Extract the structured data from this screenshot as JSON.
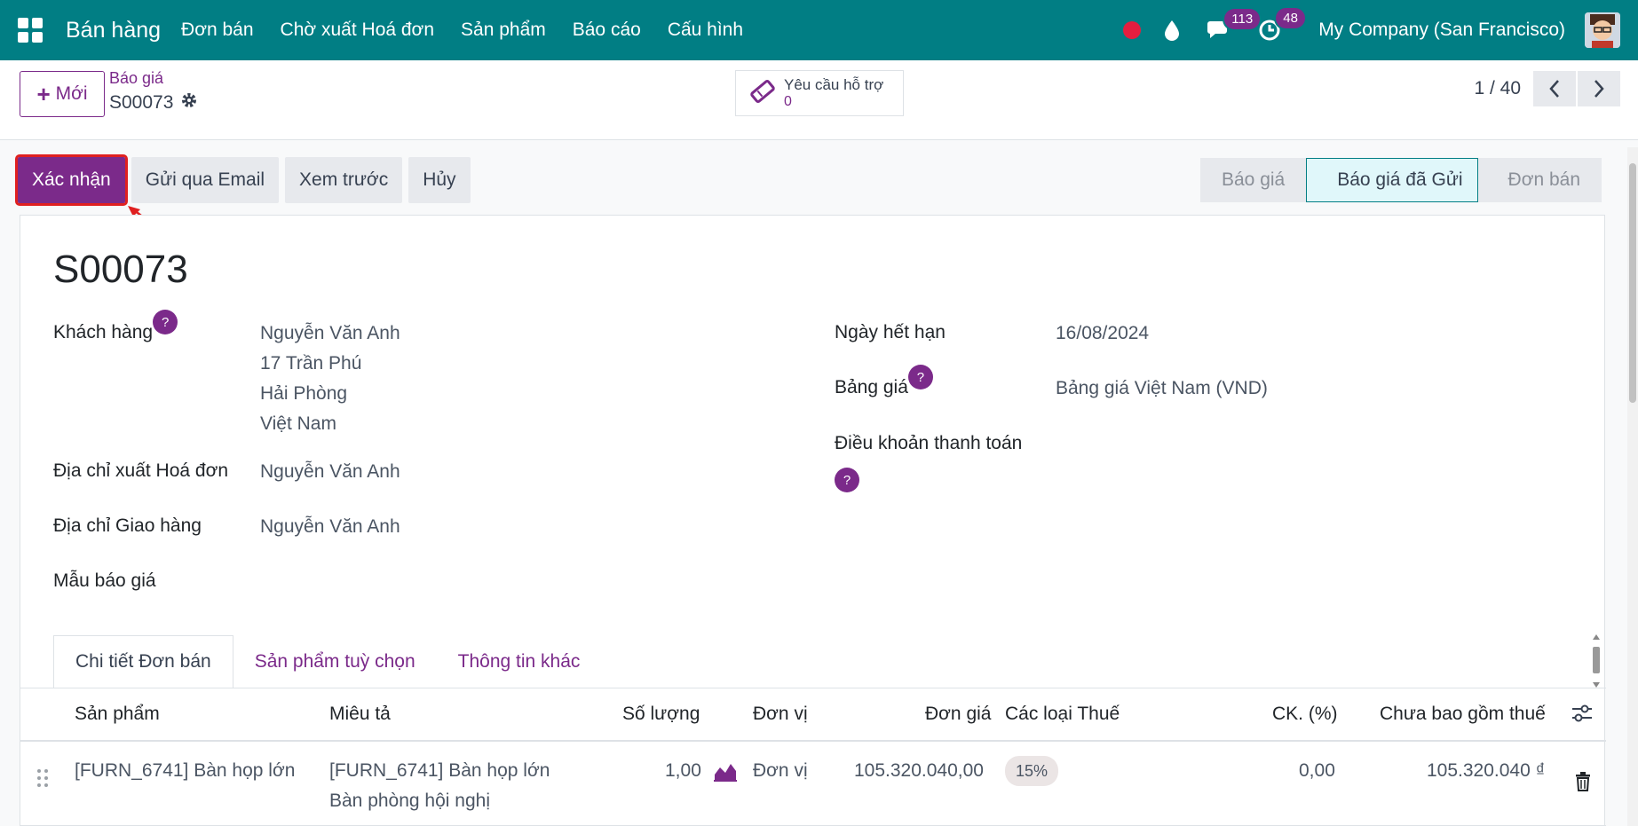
{
  "navbar": {
    "app_name": "Bán hàng",
    "menu": [
      "Đơn bán",
      "Chờ xuất Hoá đơn",
      "Sản phẩm",
      "Báo cáo",
      "Cấu hình"
    ],
    "chat_count": "113",
    "activity_count": "48",
    "company": "My Company (San Francisco)"
  },
  "control": {
    "new_label": "Mới",
    "breadcrumb_parent": "Báo giá",
    "breadcrumb_current": "S00073",
    "support_label": "Yêu cầu hỗ trợ",
    "support_count": "0",
    "pager": "1 / 40"
  },
  "actions": [
    "Xác nhận",
    "Gửi qua Email",
    "Xem trước",
    "Hủy"
  ],
  "status": {
    "stages": [
      "Báo giá",
      "Báo giá đã Gửi",
      "Đơn bán"
    ],
    "active": "Báo giá đã Gửi"
  },
  "form": {
    "title": "S00073",
    "customer_label": "Khách hàng",
    "customer_lines": [
      "Nguyễn Văn Anh",
      "17 Trần Phú",
      "Hải Phòng",
      "Việt Nam"
    ],
    "invoice_addr_label": "Địa chỉ xuất Hoá đơn",
    "invoice_addr": "Nguyễn Văn Anh",
    "delivery_addr_label": "Địa chỉ Giao hàng",
    "delivery_addr": "Nguyễn Văn Anh",
    "template_label": "Mẫu báo giá",
    "expiry_label": "Ngày hết hạn",
    "expiry": "16/08/2024",
    "pricelist_label": "Bảng giá",
    "pricelist": "Bảng giá Việt Nam (VND)",
    "payment_terms_label": "Điều khoản thanh toán",
    "help_mark": "?"
  },
  "tabs": [
    "Chi tiết Đơn bán",
    "Sản phẩm tuỳ chọn",
    "Thông tin khác"
  ],
  "table": {
    "headers": [
      "Sản phẩm",
      "Miêu tả",
      "Số lượng",
      "Đơn vị",
      "Đơn giá",
      "Các loại Thuế",
      "CK. (%)",
      "Chưa bao gồm thuế"
    ],
    "row": {
      "product": "[FURN_6741] Bàn họp lớn",
      "description_1": "[FURN_6741] Bàn họp lớn",
      "description_2": "Bàn phòng hội nghị",
      "quantity": "1,00",
      "unit": "Đơn vị",
      "price": "105.320.040,00",
      "tax": "15%",
      "discount": "0,00",
      "subtotal": "105.320.040 ₫"
    }
  }
}
